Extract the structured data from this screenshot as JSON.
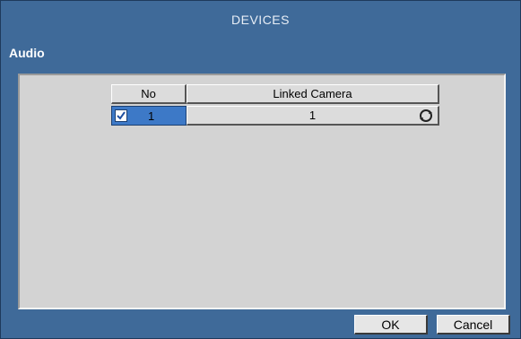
{
  "window": {
    "title": "DEVICES"
  },
  "section": {
    "label": "Audio"
  },
  "table": {
    "headers": {
      "no": "No",
      "linked_camera": "Linked Camera"
    },
    "rows": [
      {
        "checked": true,
        "no": "1",
        "linked_camera": "1",
        "action_icon": "refresh-icon"
      }
    ]
  },
  "buttons": {
    "ok": "OK",
    "cancel": "Cancel"
  },
  "colors": {
    "background": "#3f6a99",
    "panel": "#d3d3d3",
    "selected_cell": "#3d79c7"
  }
}
